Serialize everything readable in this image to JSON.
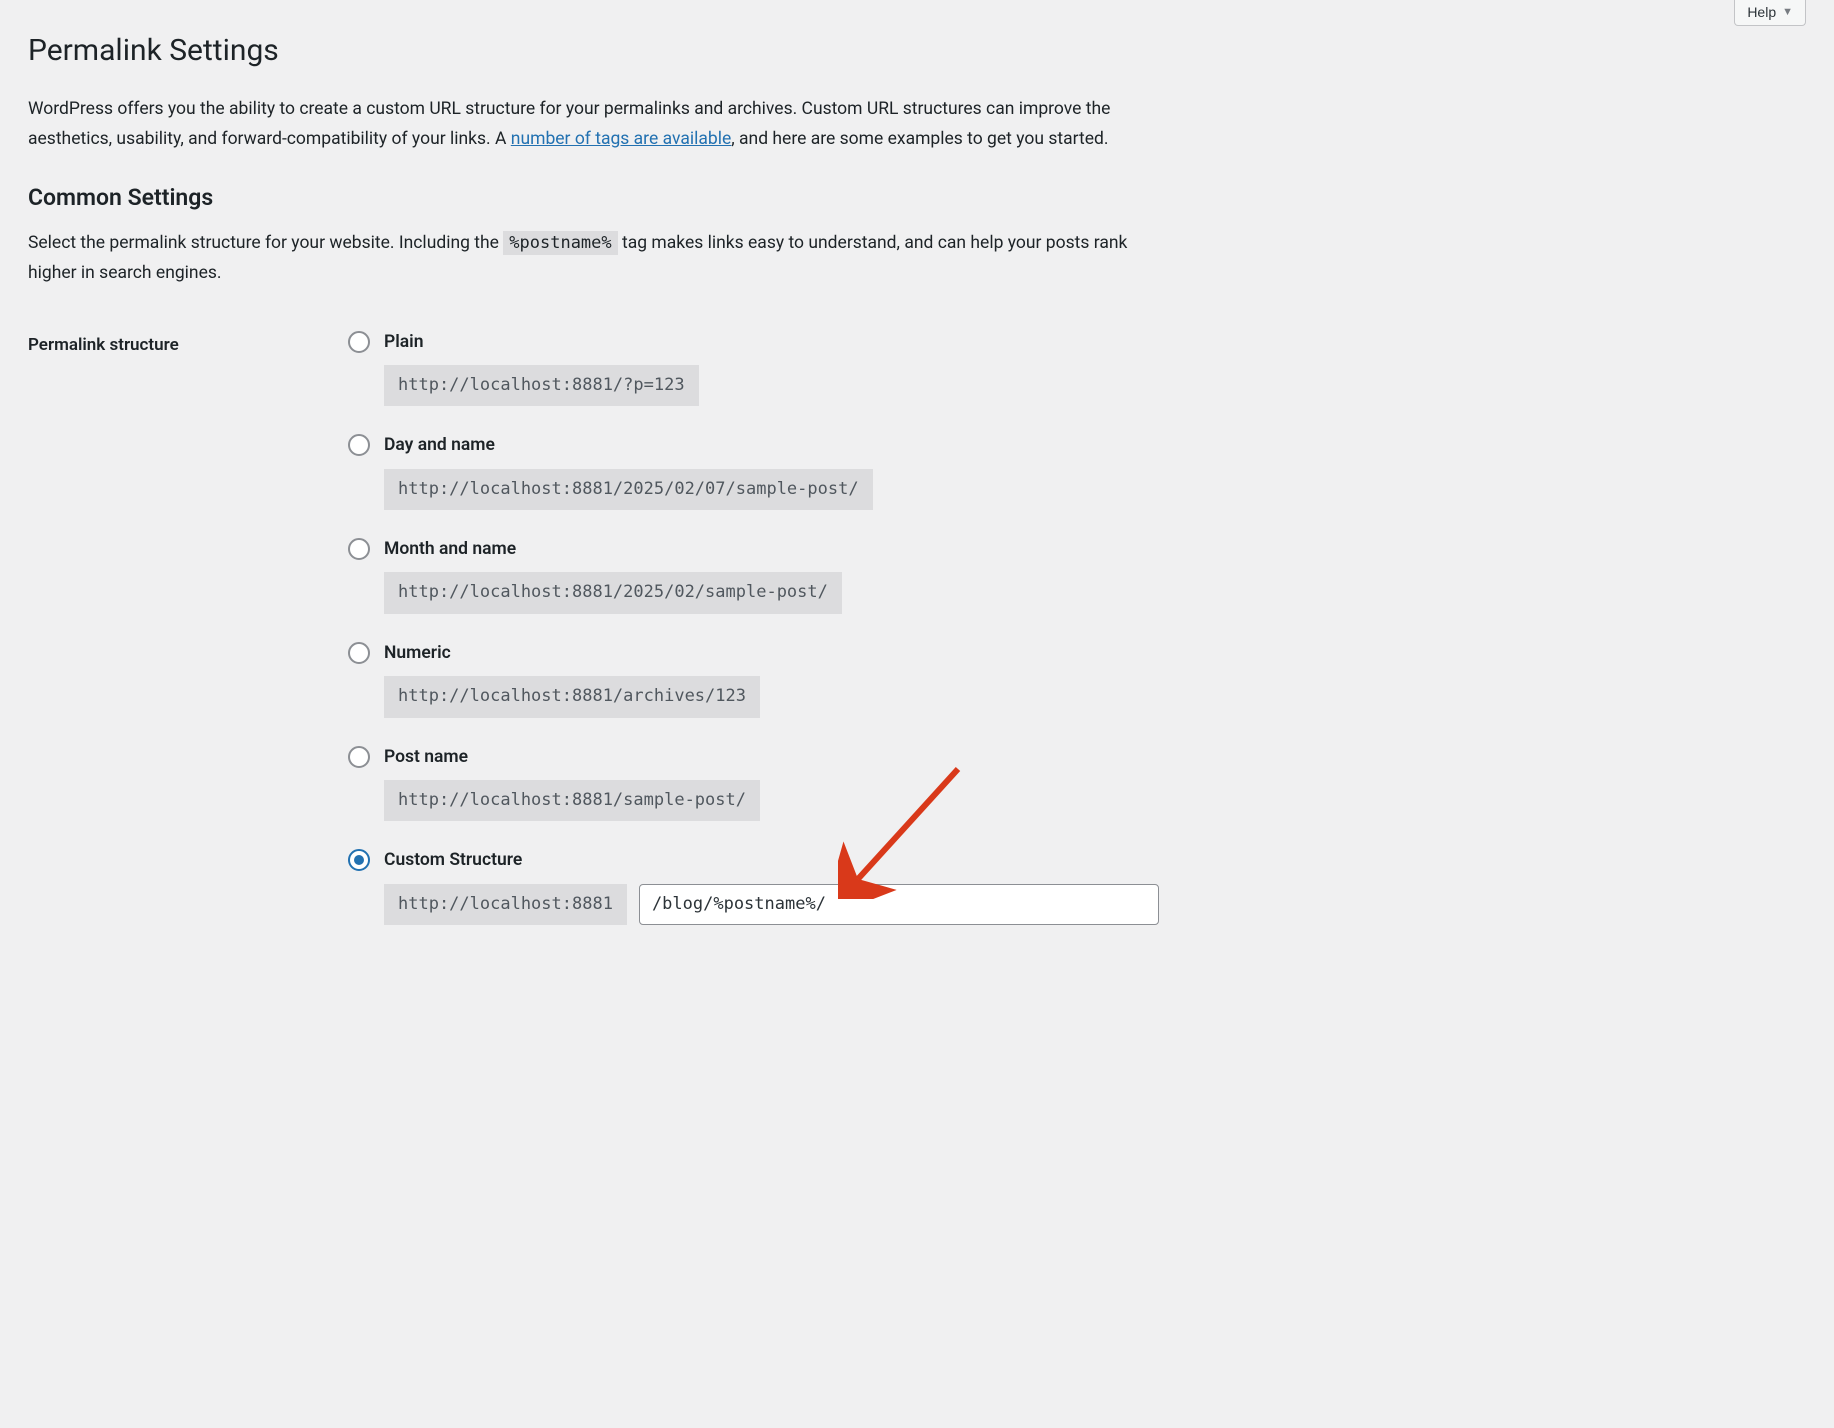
{
  "help_button": {
    "label": "Help"
  },
  "page": {
    "title": "Permalink Settings",
    "intro_before_link": "WordPress offers you the ability to create a custom URL structure for your permalinks and archives. Custom URL structures can improve the aesthetics, usability, and forward-compatibility of your links. A ",
    "intro_link_text": "number of tags are available",
    "intro_after_link": ", and here are some examples to get you started."
  },
  "common": {
    "heading": "Common Settings",
    "desc_before_code": "Select the permalink structure for your website. Including the ",
    "code_token": "%postname%",
    "desc_after_code": " tag makes links easy to understand, and can help your posts rank higher in search engines."
  },
  "structure": {
    "row_label": "Permalink structure",
    "selected": "custom",
    "options": [
      {
        "id": "plain",
        "label": "Plain",
        "example": "http://localhost:8881/?p=123"
      },
      {
        "id": "dayname",
        "label": "Day and name",
        "example": "http://localhost:8881/2025/02/07/sample-post/"
      },
      {
        "id": "monthname",
        "label": "Month and name",
        "example": "http://localhost:8881/2025/02/sample-post/"
      },
      {
        "id": "numeric",
        "label": "Numeric",
        "example": "http://localhost:8881/archives/123"
      },
      {
        "id": "postname",
        "label": "Post name",
        "example": "http://localhost:8881/sample-post/"
      }
    ],
    "custom": {
      "label": "Custom Structure",
      "prefix": "http://localhost:8881",
      "value": "/blog/%postname%/"
    }
  }
}
